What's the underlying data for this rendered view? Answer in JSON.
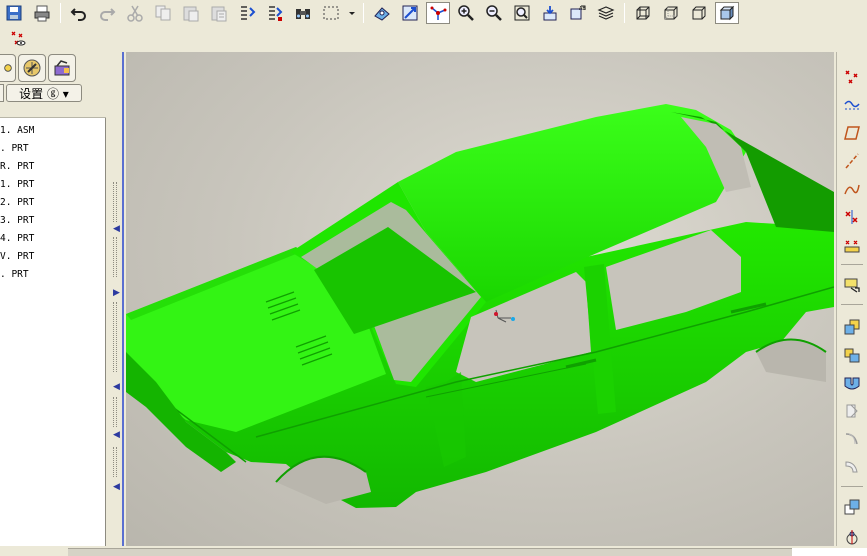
{
  "colors": {
    "car_body": "#1fe600",
    "car_shadow": "#0fa000",
    "viewport_bg": "#c8c5bc",
    "panel_bg": "#ece9d8"
  },
  "toolbar": {
    "row1_icons": [
      "save-icon",
      "print-icon",
      "undo-icon",
      "redo-icon",
      "cut-icon",
      "copy-icon",
      "paste-icon",
      "paste-special-icon",
      "regenerate-icon",
      "regenerate-manager-icon",
      "find-icon",
      "select-box-icon",
      "dropdown-arrow-icon",
      "named-view-icon",
      "orient-icon",
      "spin-center-icon",
      "zoom-in-icon",
      "zoom-out-icon",
      "refit-icon",
      "repaint-icon",
      "view-manager-icon",
      "layers-icon",
      "wireframe-icon",
      "hidden-line-icon",
      "no-hidden-icon",
      "shading-icon"
    ],
    "row2_icons": [
      "datum-point-display-icon"
    ]
  },
  "left_panel": {
    "settings_label": "设置 ⓖ ▾",
    "tree_items": [
      "1. ASM",
      ". PRT",
      "R. PRT",
      "1. PRT",
      "2. PRT",
      "3. PRT",
      "4. PRT",
      "V. PRT",
      ". PRT"
    ]
  },
  "right_toolbar": {
    "icons": [
      "datum-point-icon",
      "datum-curve-sketch-icon",
      "datum-plane-icon",
      "datum-axis-icon",
      "datum-curve-icon",
      "datum-point-offset-icon",
      "coordinate-system-icon",
      "analysis-icon",
      "copy-feature-icon",
      "mirror-icon",
      "merge-icon",
      "trim-icon",
      "offset-icon",
      "thicken-icon",
      "solidify-icon",
      "extend-icon",
      "pattern-icon"
    ]
  }
}
